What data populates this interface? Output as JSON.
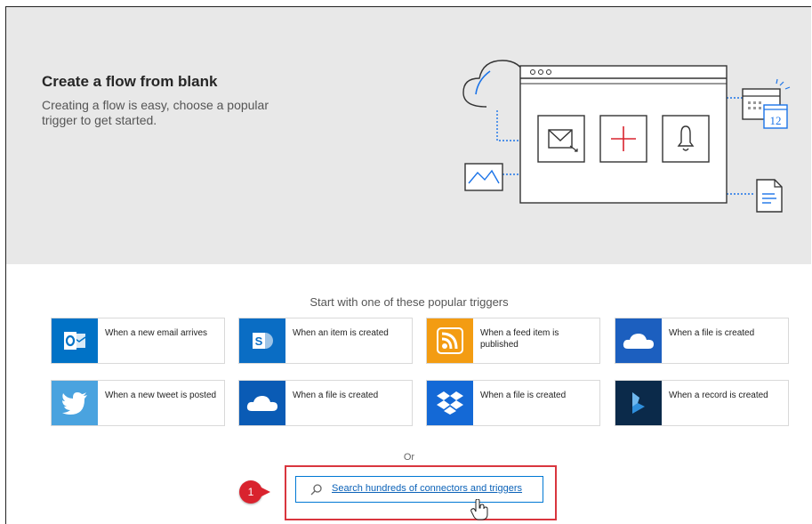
{
  "hero": {
    "title": "Create a flow from blank",
    "subtitle": "Creating a flow is easy, choose a popular trigger to get started.",
    "calendar_day": "12",
    "background": "#e8e8e8"
  },
  "triggers": {
    "heading": "Start with one of these popular triggers",
    "items": [
      {
        "label": "When a new email arrives",
        "service": "outlook",
        "icon": "outlook-icon",
        "color": "#0072c6"
      },
      {
        "label": "When an item is created",
        "service": "sharepoint",
        "icon": "sharepoint-icon",
        "color": "#0a6dc4"
      },
      {
        "label": "When a feed item is published",
        "service": "rss",
        "icon": "rss-icon",
        "color": "#f39c12"
      },
      {
        "label": "When a file is created",
        "service": "onedrive",
        "icon": "onedrive-icon",
        "color": "#1c5fbf"
      },
      {
        "label": "When a new tweet is posted",
        "service": "twitter",
        "icon": "twitter-icon",
        "color": "#4aa3df"
      },
      {
        "label": "When a file is created",
        "service": "onedrive-business",
        "icon": "onedrive-icon",
        "color": "#0a5bb5"
      },
      {
        "label": "When a file is created",
        "service": "dropbox",
        "icon": "dropbox-icon",
        "color": "#1469d6"
      },
      {
        "label": "When a record is created",
        "service": "dynamics",
        "icon": "dynamics-icon",
        "color": "#0b2a4a"
      }
    ]
  },
  "search": {
    "or_label": "Or",
    "button_label": "Search hundreds of connectors and triggers",
    "icon": "search-icon",
    "accent": "#0078d4"
  },
  "annotation": {
    "step_number": "1",
    "color": "#d9232e"
  }
}
